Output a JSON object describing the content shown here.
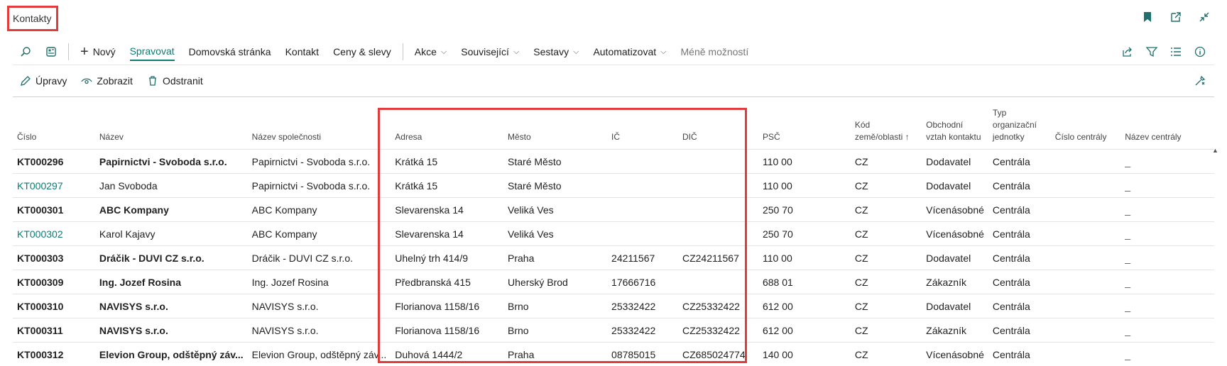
{
  "page": {
    "title": "Kontakty"
  },
  "toolbar": {
    "items": [
      {
        "label": "Nový",
        "icon": "plus-icon"
      },
      {
        "label": "Spravovat"
      },
      {
        "label": "Domovská stránka"
      },
      {
        "label": "Kontakt"
      },
      {
        "label": "Ceny & slevy"
      },
      {
        "label": "Akce"
      },
      {
        "label": "Související"
      },
      {
        "label": "Sestavy"
      },
      {
        "label": "Automatizovat"
      },
      {
        "label": "Méně možností"
      }
    ]
  },
  "actions": {
    "edit": "Úpravy",
    "view": "Zobrazit",
    "delete": "Odstranit"
  },
  "table": {
    "columns": [
      "Číslo",
      "Název",
      "Název společnosti",
      "Adresa",
      "Město",
      "IČ",
      "DIČ",
      "PSČ",
      "Kód země/oblasti ↑",
      "Obchodní vztah kontaktu",
      "Typ organizační jednotky",
      "Číslo centrály",
      "Název centrály"
    ],
    "rows": [
      {
        "cislo": "KT000296",
        "nazev": "Papirnictvi - Svoboda s.r.o.",
        "spolecnost": "Papirnictvi - Svoboda s.r.o.",
        "adresa": "Krátká 15",
        "mesto": "Staré Město",
        "ic": "",
        "dic": "",
        "psc": "110 00",
        "kod": "CZ",
        "vztah": "Dodavatel",
        "typ": "Centrála",
        "cislo_c": "",
        "nazev_c": "_",
        "bold": true,
        "link": false
      },
      {
        "cislo": "KT000297",
        "nazev": "Jan Svoboda",
        "spolecnost": "Papirnictvi - Svoboda s.r.o.",
        "adresa": "Krátká 15",
        "mesto": "Staré Město",
        "ic": "",
        "dic": "",
        "psc": "110 00",
        "kod": "CZ",
        "vztah": "Dodavatel",
        "typ": "Centrála",
        "cislo_c": "",
        "nazev_c": "_",
        "bold": false,
        "link": true
      },
      {
        "cislo": "KT000301",
        "nazev": "ABC Kompany",
        "spolecnost": "ABC Kompany",
        "adresa": "Slevarenska 14",
        "mesto": "Veliká Ves",
        "ic": "",
        "dic": "",
        "psc": "250 70",
        "kod": "CZ",
        "vztah": "Vícenásobné",
        "typ": "Centrála",
        "cislo_c": "",
        "nazev_c": "_",
        "bold": true,
        "link": false
      },
      {
        "cislo": "KT000302",
        "nazev": "Karol Kajavy",
        "spolecnost": "ABC Kompany",
        "adresa": "Slevarenska 14",
        "mesto": "Veliká Ves",
        "ic": "",
        "dic": "",
        "psc": "250 70",
        "kod": "CZ",
        "vztah": "Vícenásobné",
        "typ": "Centrála",
        "cislo_c": "",
        "nazev_c": "_",
        "bold": false,
        "link": true
      },
      {
        "cislo": "KT000303",
        "nazev": "Dráčik - DUVI CZ s.r.o.",
        "spolecnost": "Dráčik - DUVI CZ s.r.o.",
        "adresa": "Uhelný trh 414/9",
        "mesto": "Praha",
        "ic": "24211567",
        "dic": "CZ24211567",
        "psc": "110 00",
        "kod": "CZ",
        "vztah": "Dodavatel",
        "typ": "Centrála",
        "cislo_c": "",
        "nazev_c": "_",
        "bold": true,
        "link": false
      },
      {
        "cislo": "KT000309",
        "nazev": "Ing. Jozef Rosina",
        "spolecnost": "Ing. Jozef Rosina",
        "adresa": "Předbranská 415",
        "mesto": "Uherský Brod",
        "ic": "17666716",
        "dic": "",
        "psc": "688 01",
        "kod": "CZ",
        "vztah": "Zákazník",
        "typ": "Centrála",
        "cislo_c": "",
        "nazev_c": "_",
        "bold": true,
        "link": false
      },
      {
        "cislo": "KT000310",
        "nazev": "NAVISYS s.r.o.",
        "spolecnost": "NAVISYS s.r.o.",
        "adresa": "Florianova 1158/16",
        "mesto": "Brno",
        "ic": "25332422",
        "dic": "CZ25332422",
        "psc": "612 00",
        "kod": "CZ",
        "vztah": "Dodavatel",
        "typ": "Centrála",
        "cislo_c": "",
        "nazev_c": "_",
        "bold": true,
        "link": false
      },
      {
        "cislo": "KT000311",
        "nazev": "NAVISYS s.r.o.",
        "spolecnost": "NAVISYS s.r.o.",
        "adresa": "Florianova 1158/16",
        "mesto": "Brno",
        "ic": "25332422",
        "dic": "CZ25332422",
        "psc": "612 00",
        "kod": "CZ",
        "vztah": "Zákazník",
        "typ": "Centrála",
        "cislo_c": "",
        "nazev_c": "_",
        "bold": true,
        "link": false
      },
      {
        "cislo": "KT000312",
        "nazev": "Elevion Group, odštěpný záv...",
        "spolecnost": "Elevion Group, odštěpný záv...",
        "adresa": "Duhová 1444/2",
        "mesto": "Praha",
        "ic": "08785015",
        "dic": "CZ685024774",
        "psc": "140 00",
        "kod": "CZ",
        "vztah": "Vícenásobné",
        "typ": "Centrála",
        "cislo_c": "",
        "nazev_c": "_",
        "bold": true,
        "link": false
      }
    ]
  }
}
